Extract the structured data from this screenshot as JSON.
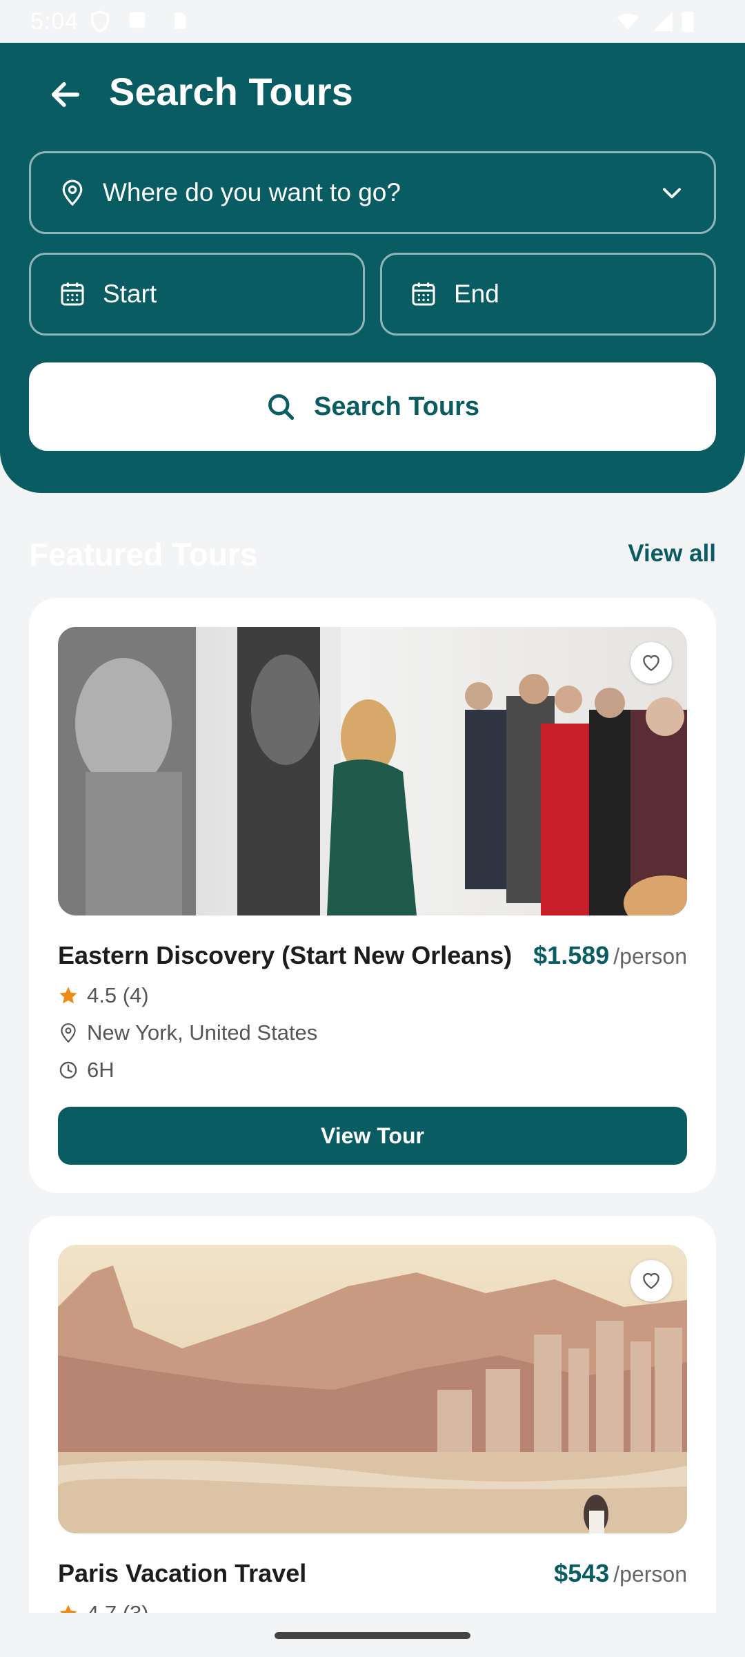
{
  "status_bar": {
    "time": "5:04"
  },
  "header": {
    "title": "Search Tours",
    "destination_placeholder": "Where do you want to go?",
    "start_label": "Start",
    "end_label": "End",
    "search_button_label": "Search Tours"
  },
  "section": {
    "title": "Featured Tours",
    "view_all": "View all"
  },
  "tours": [
    {
      "name": "Eastern Discovery (Start New Orleans)",
      "price": "$1.589",
      "per": "/person",
      "rating": "4.5 (4)",
      "location": "New York, United States",
      "duration": "6H",
      "button": "View Tour"
    },
    {
      "name": "Paris Vacation Travel",
      "price": "$543",
      "per": "/person",
      "rating": "4.7 (3)"
    }
  ],
  "colors": {
    "primary": "#0a5c63",
    "star": "#f08a16",
    "background": "#f3f4f6"
  }
}
